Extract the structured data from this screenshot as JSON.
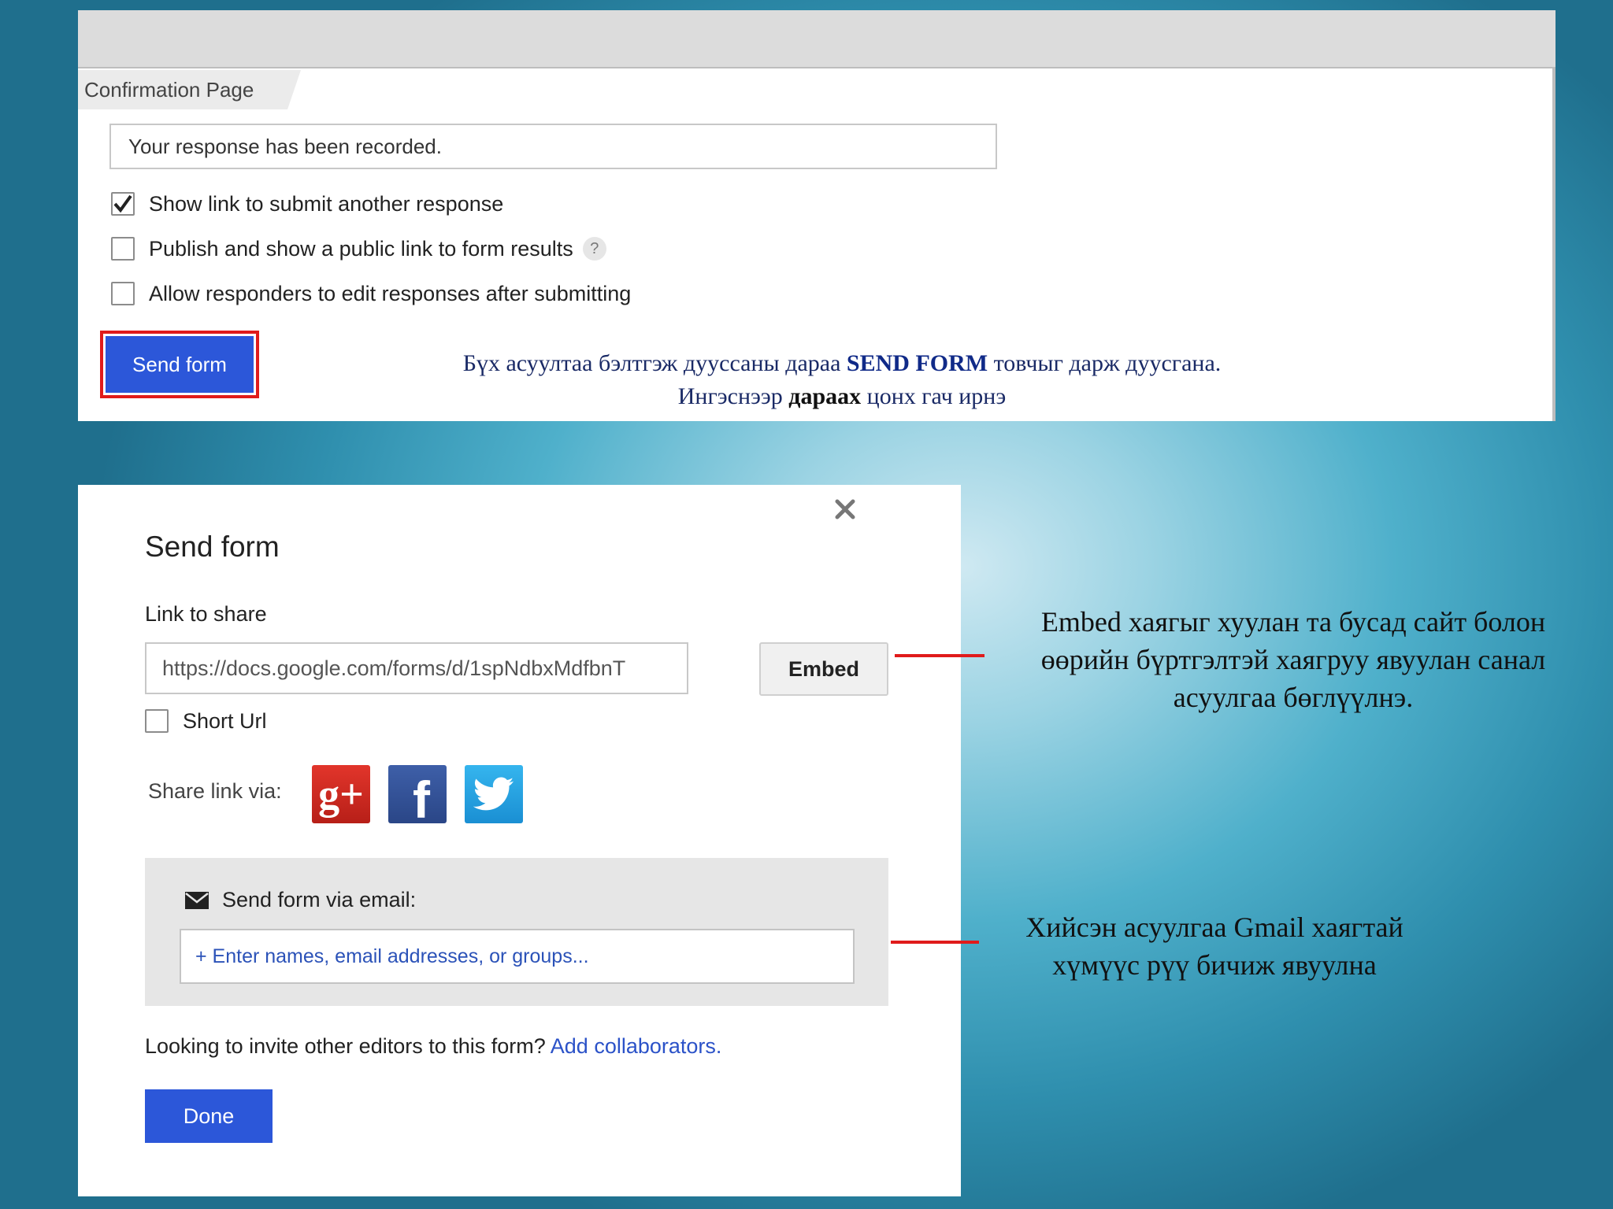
{
  "confirmation": {
    "section_tab": "Confirmation Page",
    "message_value": "Your response has been recorded.",
    "options": [
      {
        "label": "Show link to submit another response",
        "checked": true
      },
      {
        "label": "Publish and show a public link to form results",
        "checked": false
      },
      {
        "label": "Allow responders to edit responses after submitting",
        "checked": false
      }
    ],
    "help_icon": "?",
    "send_button": "Send form",
    "caption_line1_pre": "Бүх асуултаа бэлтгэж дууссаны дараа ",
    "caption_line1_bold": "SEND FORM",
    "caption_line1_post": " товчыг дарж дуусгана.",
    "caption_line2_pre": "Ингэснээр ",
    "caption_line2_bold": "дараах",
    "caption_line2_post": " цонх гач ирнэ"
  },
  "dialog": {
    "close_icon": "close-icon",
    "title": "Send form",
    "link_label": "Link to share",
    "link_value": "https://docs.google.com/forms/d/1spNdbxMdfbnT",
    "embed_button": "Embed",
    "short_url_label": "Short Url",
    "share_via_label": "Share link via:",
    "social": [
      "google-plus-icon",
      "facebook-icon",
      "twitter-icon"
    ],
    "gplus_text": "g+",
    "facebook_text": "f",
    "email_heading": "Send form via email:",
    "email_placeholder": "+ Enter names, email addresses, or groups...",
    "invite_text": "Looking to invite other editors to this form? ",
    "invite_link": "Add collaborators.",
    "done_button": "Done"
  },
  "annotations": {
    "embed_note": "Embed хаягыг хуулан та бусад сайт болон өөрийн бүртгэлтэй хаягруу явуулан санал асуулгаа бөглүүлнэ.",
    "email_note": "Хийсэн асуулгаа Gmail хаягтай хүмүүс рүү бичиж явуулна"
  },
  "colors": {
    "primary_button": "#2c57d9",
    "highlight": "#e01b1b",
    "link": "#2b52c8"
  }
}
